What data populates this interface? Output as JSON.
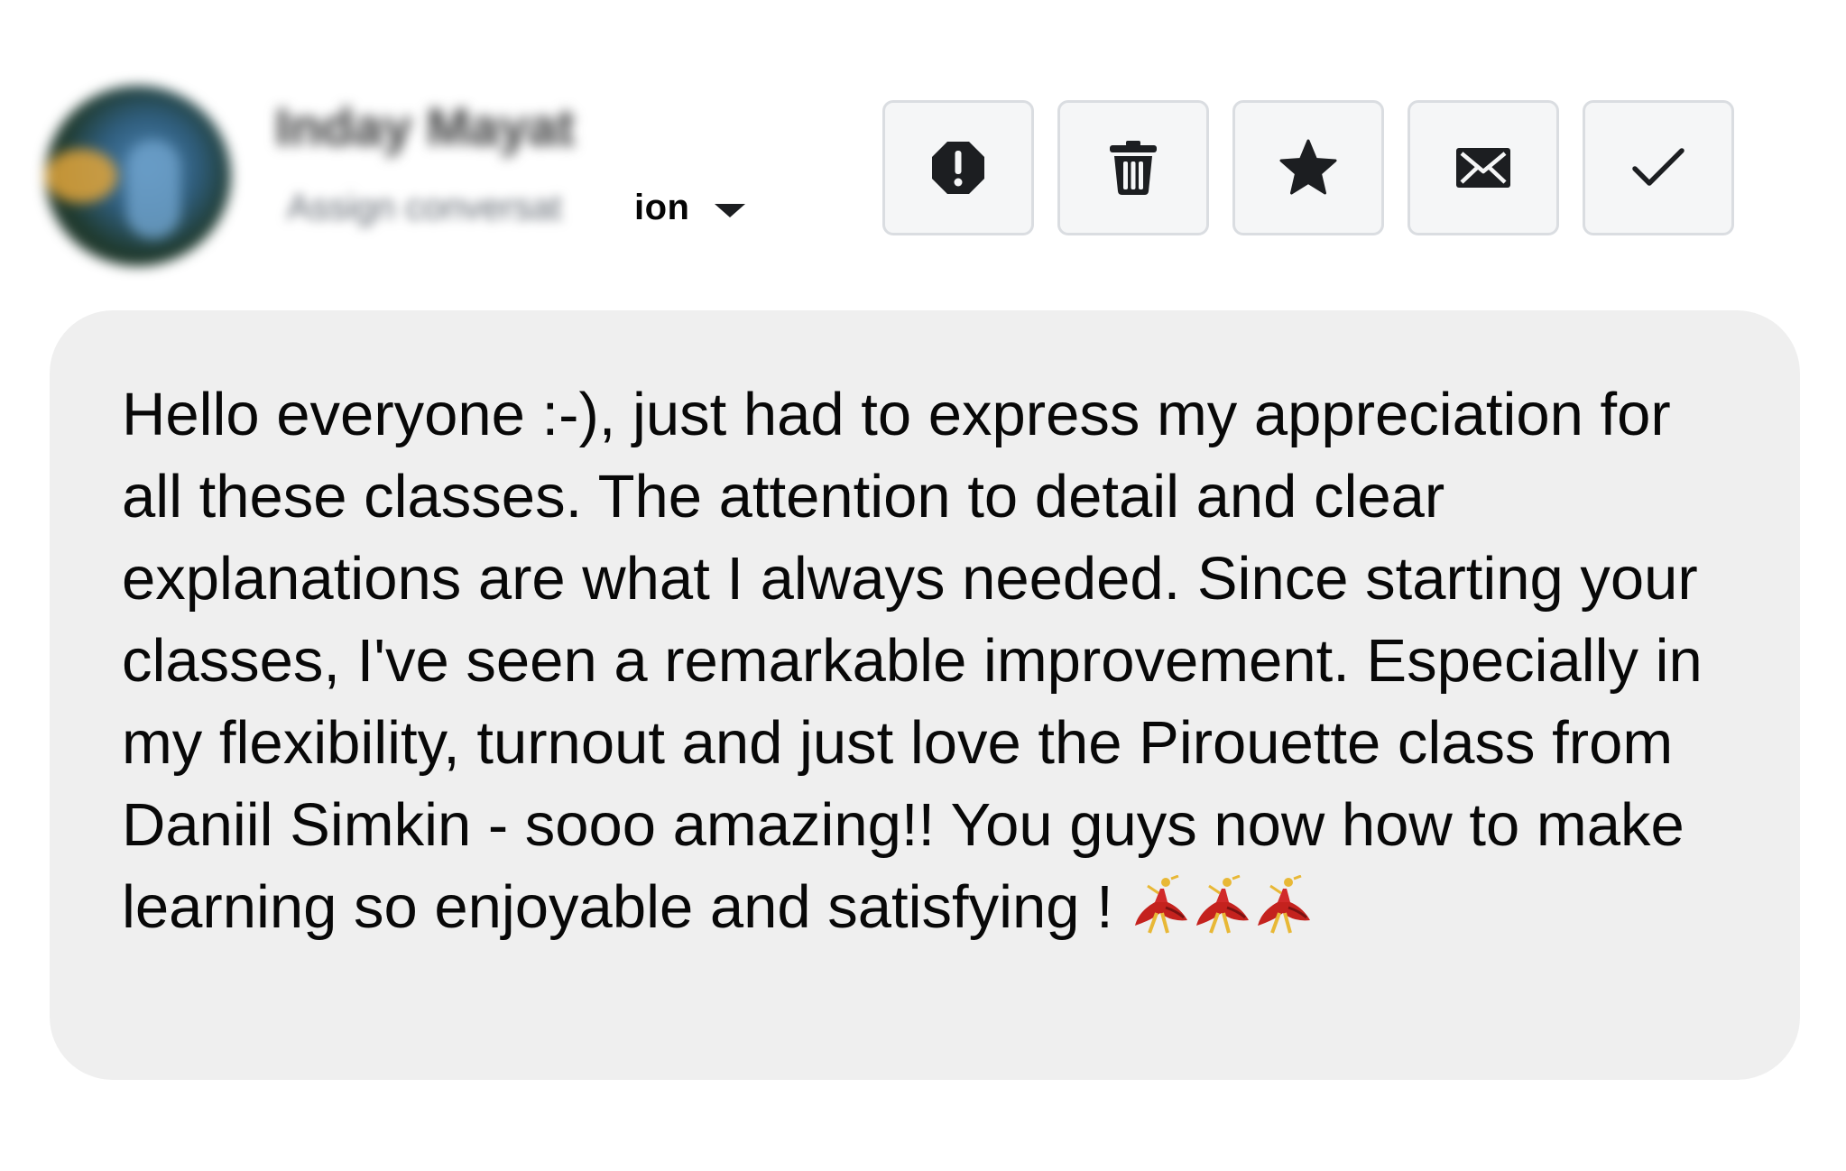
{
  "header": {
    "user_name": "Inday Mayat",
    "assign_label_hidden": "Assign conversat",
    "assign_label_visible": "ion"
  },
  "toolbar": {
    "buttons": [
      {
        "icon": "exclamation-octagon-icon",
        "label": "Mark as spam"
      },
      {
        "icon": "trash-icon",
        "label": "Delete"
      },
      {
        "icon": "star-icon",
        "label": "Star"
      },
      {
        "icon": "envelope-icon",
        "label": "Mark as unread"
      },
      {
        "icon": "checkmark-icon",
        "label": "Mark as done"
      }
    ]
  },
  "message": {
    "text": "Hello everyone :-), just had to express my appreciation for all these classes. The attention to detail and clear explanations are what I always needed. Since starting your classes, I've seen a remarkable improvement. Especially in my flexibility, turnout and just love the Pirouette class from Daniil Simkin - sooo amazing!! You guys now how to make learning so enjoyable and satisfying !",
    "emoji": [
      "dancer-emoji",
      "dancer-emoji",
      "dancer-emoji"
    ]
  },
  "colors": {
    "bubble_background": "#efefef",
    "button_background": "#f5f6f7",
    "button_border": "#dadde1",
    "icon_color": "#1c1e21",
    "text_color": "#080808"
  }
}
